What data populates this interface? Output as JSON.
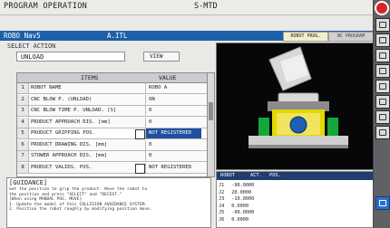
{
  "window": {
    "title": "PROGRAM OPERATION",
    "machine": "S-MTD"
  },
  "program_bar": {
    "robot_name": "ROBO Nav5",
    "program_name": "A.ITL"
  },
  "tabs": [
    {
      "label": "ROBOT PROG.",
      "active": true
    },
    {
      "label": "NC PROGRAM",
      "active": false
    }
  ],
  "select_action": {
    "label": "SELECT ACTION",
    "value": "UNLOAD",
    "view_button": "VIEW"
  },
  "table": {
    "headers": [
      "ITEMS",
      "VALUE"
    ],
    "rows": [
      {
        "num": "1",
        "item": "ROBOT NAME",
        "value": "ROBO A",
        "pickable": false,
        "selected": false
      },
      {
        "num": "2",
        "item": "CNC BLOW P. (UNLOAD)",
        "value": "ON",
        "pickable": false,
        "selected": false
      },
      {
        "num": "3",
        "item": "CNC BLOW TIME P. UNLOAD. [S]",
        "value": "0",
        "pickable": false,
        "selected": false
      },
      {
        "num": "4",
        "item": "PRODUCT APPROACH DIS. [mm]",
        "value": "0",
        "pickable": false,
        "selected": false
      },
      {
        "num": "5",
        "item": "PRODUCT GRIPPING POS.",
        "value": "NOT REGISTERED",
        "pickable": true,
        "selected": true
      },
      {
        "num": "6",
        "item": "PRODUCT DRAWING DIS. [mm]",
        "value": "0",
        "pickable": false,
        "selected": false
      },
      {
        "num": "7",
        "item": "STOWER APPROACH DIS. [mm]",
        "value": "0",
        "pickable": false,
        "selected": false
      },
      {
        "num": "8",
        "item": "PRODUCT VALIDS. POS.",
        "value": "NOT REGISTERED",
        "pickable": true,
        "selected": false
      }
    ]
  },
  "guidance": {
    "title": "[GUIDANCE]",
    "text": "Set the position to grip the product. Move the robot to\nthe position and press \"SELECT\" and \"RECEST.\"\n[When using MANUAL POS. MOVE]\n1. Update the model of this COLLISION AVOIDANCE SYSTEM.\n2. Position the robot roughly by modifying position move."
  },
  "coords": {
    "headers": [
      "ROBOT",
      "ACT.",
      "POS."
    ],
    "lines": [
      [
        "J1",
        "-90.0000",
        ""
      ],
      [
        "J2",
        "20.0000",
        ""
      ],
      [
        "J3",
        "-10.0000",
        ""
      ],
      [
        "J4",
        "0.0000",
        ""
      ],
      [
        "J5",
        "-90.0000",
        ""
      ],
      [
        "J6",
        "0.0000",
        ""
      ]
    ]
  },
  "colors": {
    "accent_blue": "#1e5fa9",
    "selected_row": "#1f4fa0",
    "viewer_background": "#070707",
    "logo_red": "#d8232a"
  },
  "icons": {
    "rail": [
      "logo-icon",
      "monitor-icon",
      "program-icon",
      "setup-icon",
      "camera-icon",
      "tool-icon",
      "grid-icon",
      "menu-icon",
      "home-icon",
      "power-icon"
    ],
    "pick": "target-icon"
  }
}
